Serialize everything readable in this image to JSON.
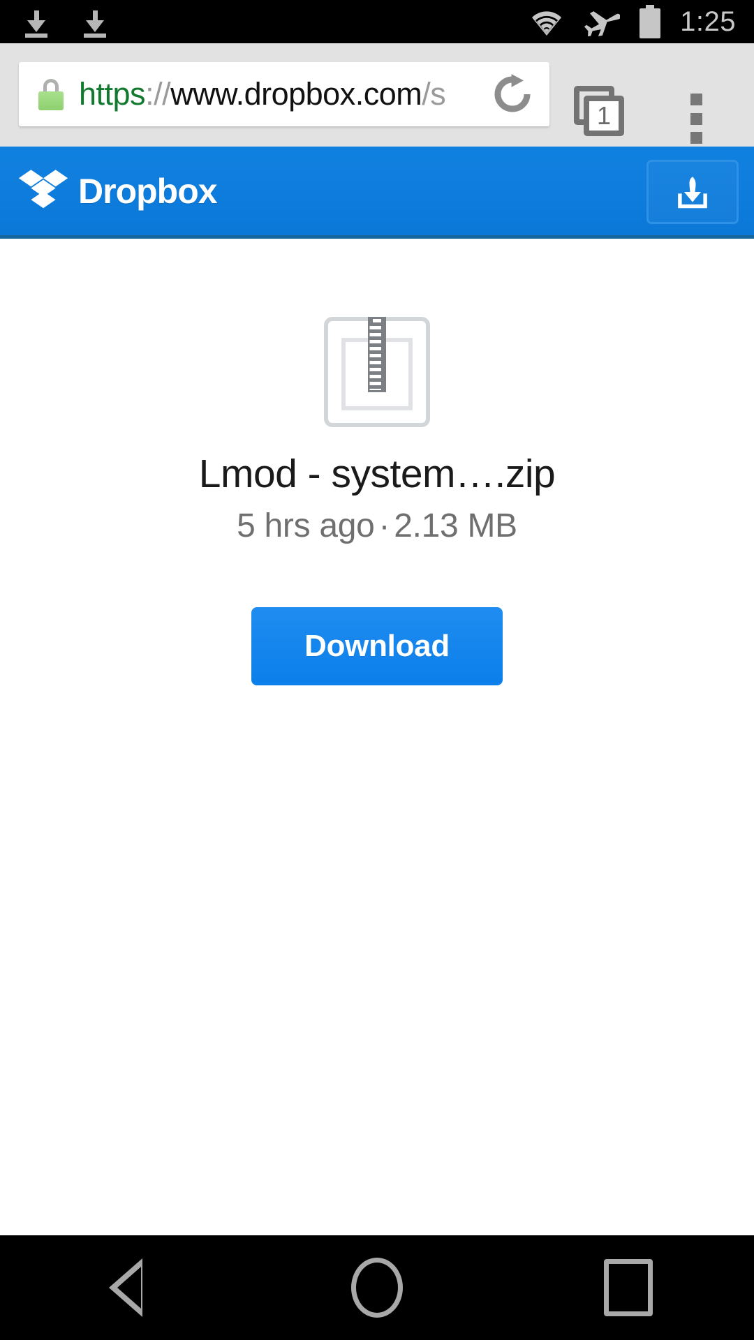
{
  "status_bar": {
    "notifications": [
      "download-arrow",
      "download-arrow"
    ],
    "icons": [
      "wifi-icon",
      "airplane-mode-icon",
      "battery-icon"
    ],
    "time": "1:25"
  },
  "browser": {
    "omnibox": {
      "secure_icon": "lock-icon",
      "scheme": "https",
      "separator": "://",
      "host": "www.dropbox.com",
      "path": "/s",
      "full_url": "https://www.dropbox.com/s",
      "reload_icon": "reload-icon"
    },
    "tabs": {
      "icon": "tabs-stack-icon",
      "count": "1"
    },
    "menu": {
      "icon": "overflow-menu-icon",
      "label": "More options"
    }
  },
  "site_header": {
    "brand_name": "Dropbox",
    "logo_icon": "dropbox-logo-icon",
    "save_button": {
      "icon": "save-to-dropbox-icon",
      "label": "Save to Dropbox"
    },
    "background_color": "#0f7dda",
    "border_color": "#15659f"
  },
  "file": {
    "type_icon": "zip-file-icon",
    "name": "Lmod - system….zip",
    "modified": "5 hrs ago",
    "separator": "·",
    "size": "2.13 MB",
    "download_label": "Download",
    "download_color": "#1286ee"
  },
  "nav_bar": {
    "back": "back-icon",
    "home": "home-icon",
    "recents": "recents-icon"
  }
}
